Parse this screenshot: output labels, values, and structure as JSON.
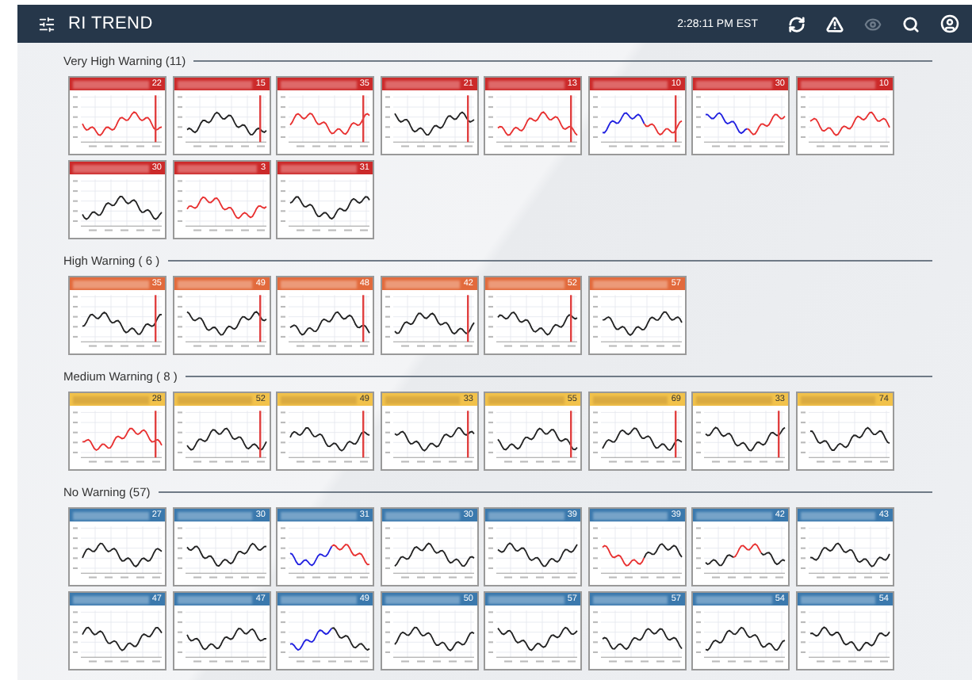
{
  "app_bar": {
    "title": "RI TREND",
    "time": "2:28:11 PM EST"
  },
  "sections": [
    {
      "title": "Very High Warning (11)",
      "kind": "very_high",
      "cards": [
        {
          "value": "22",
          "segments": [
            {
              "color": "#e83030"
            }
          ],
          "marker": true
        },
        {
          "value": "15",
          "segments": [
            {
              "color": "#222222"
            }
          ],
          "marker": true
        },
        {
          "value": "35",
          "segments": [
            {
              "color": "#e83030"
            }
          ],
          "marker": true
        },
        {
          "value": "21",
          "segments": [
            {
              "color": "#222222"
            }
          ],
          "marker": true
        },
        {
          "value": "13",
          "segments": [
            {
              "color": "#e83030"
            }
          ],
          "marker": true
        },
        {
          "value": "10",
          "segments": [
            {
              "color": "#2020e0"
            },
            {
              "color": "#e83030"
            }
          ],
          "marker": true
        },
        {
          "value": "30",
          "segments": [
            {
              "color": "#2020e0"
            },
            {
              "color": "#e83030"
            }
          ],
          "marker": false
        },
        {
          "value": "10",
          "segments": [
            {
              "color": "#e83030"
            }
          ],
          "marker": false
        },
        {
          "value": "30",
          "segments": [
            {
              "color": "#222222"
            }
          ],
          "marker": false
        },
        {
          "value": "3",
          "segments": [
            {
              "color": "#e83030"
            }
          ],
          "marker": false
        },
        {
          "value": "31",
          "segments": [
            {
              "color": "#222222"
            }
          ],
          "marker": false
        }
      ]
    },
    {
      "title": "High Warning ( 6 )",
      "kind": "high",
      "cards": [
        {
          "value": "35",
          "segments": [
            {
              "color": "#222222"
            }
          ],
          "marker": true
        },
        {
          "value": "49",
          "segments": [
            {
              "color": "#222222"
            }
          ],
          "marker": true
        },
        {
          "value": "48",
          "segments": [
            {
              "color": "#222222"
            }
          ],
          "marker": true
        },
        {
          "value": "42",
          "segments": [
            {
              "color": "#222222"
            }
          ],
          "marker": true
        },
        {
          "value": "52",
          "segments": [
            {
              "color": "#222222"
            }
          ],
          "marker": true
        },
        {
          "value": "57",
          "segments": [
            {
              "color": "#222222"
            }
          ],
          "marker": false
        }
      ]
    },
    {
      "title": "Medium Warning ( 8 )",
      "kind": "medium",
      "cards": [
        {
          "value": "28",
          "segments": [
            {
              "color": "#e83030"
            }
          ],
          "marker": true
        },
        {
          "value": "52",
          "segments": [
            {
              "color": "#222222"
            }
          ],
          "marker": true
        },
        {
          "value": "49",
          "segments": [
            {
              "color": "#222222"
            }
          ],
          "marker": true
        },
        {
          "value": "33",
          "segments": [
            {
              "color": "#222222"
            }
          ],
          "marker": true
        },
        {
          "value": "55",
          "segments": [
            {
              "color": "#222222"
            }
          ],
          "marker": true
        },
        {
          "value": "69",
          "segments": [
            {
              "color": "#222222"
            }
          ],
          "marker": true
        },
        {
          "value": "33",
          "segments": [
            {
              "color": "#222222"
            }
          ],
          "marker": true
        },
        {
          "value": "74",
          "segments": [
            {
              "color": "#222222"
            }
          ],
          "marker": false
        }
      ]
    },
    {
      "title": "No Warning (57)",
      "kind": "none",
      "cards": [
        {
          "value": "27",
          "segments": [
            {
              "color": "#222222"
            }
          ],
          "marker": false
        },
        {
          "value": "30",
          "segments": [
            {
              "color": "#222222"
            }
          ],
          "marker": false
        },
        {
          "value": "31",
          "segments": [
            {
              "color": "#2020e0"
            },
            {
              "color": "#e83030"
            }
          ],
          "marker": false
        },
        {
          "value": "30",
          "segments": [
            {
              "color": "#222222"
            }
          ],
          "marker": false
        },
        {
          "value": "39",
          "segments": [
            {
              "color": "#222222"
            }
          ],
          "marker": false
        },
        {
          "value": "39",
          "segments": [
            {
              "color": "#e83030"
            },
            {
              "color": "#222222"
            }
          ],
          "marker": false
        },
        {
          "value": "42",
          "segments": [
            {
              "color": "#222222"
            },
            {
              "color": "#e83030"
            },
            {
              "color": "#222222"
            }
          ],
          "marker": false
        },
        {
          "value": "43",
          "segments": [
            {
              "color": "#222222"
            }
          ],
          "marker": false
        },
        {
          "value": "47",
          "segments": [
            {
              "color": "#222222"
            }
          ],
          "marker": false
        },
        {
          "value": "47",
          "segments": [
            {
              "color": "#222222"
            }
          ],
          "marker": false
        },
        {
          "value": "49",
          "segments": [
            {
              "color": "#2020e0"
            },
            {
              "color": "#222222"
            }
          ],
          "marker": false
        },
        {
          "value": "50",
          "segments": [
            {
              "color": "#222222"
            }
          ],
          "marker": false
        },
        {
          "value": "57",
          "segments": [
            {
              "color": "#222222"
            }
          ],
          "marker": false
        },
        {
          "value": "57",
          "segments": [
            {
              "color": "#222222"
            }
          ],
          "marker": false
        },
        {
          "value": "54",
          "segments": [
            {
              "color": "#222222"
            }
          ],
          "marker": false
        },
        {
          "value": "54",
          "segments": [
            {
              "color": "#222222"
            }
          ],
          "marker": false
        }
      ]
    }
  ]
}
